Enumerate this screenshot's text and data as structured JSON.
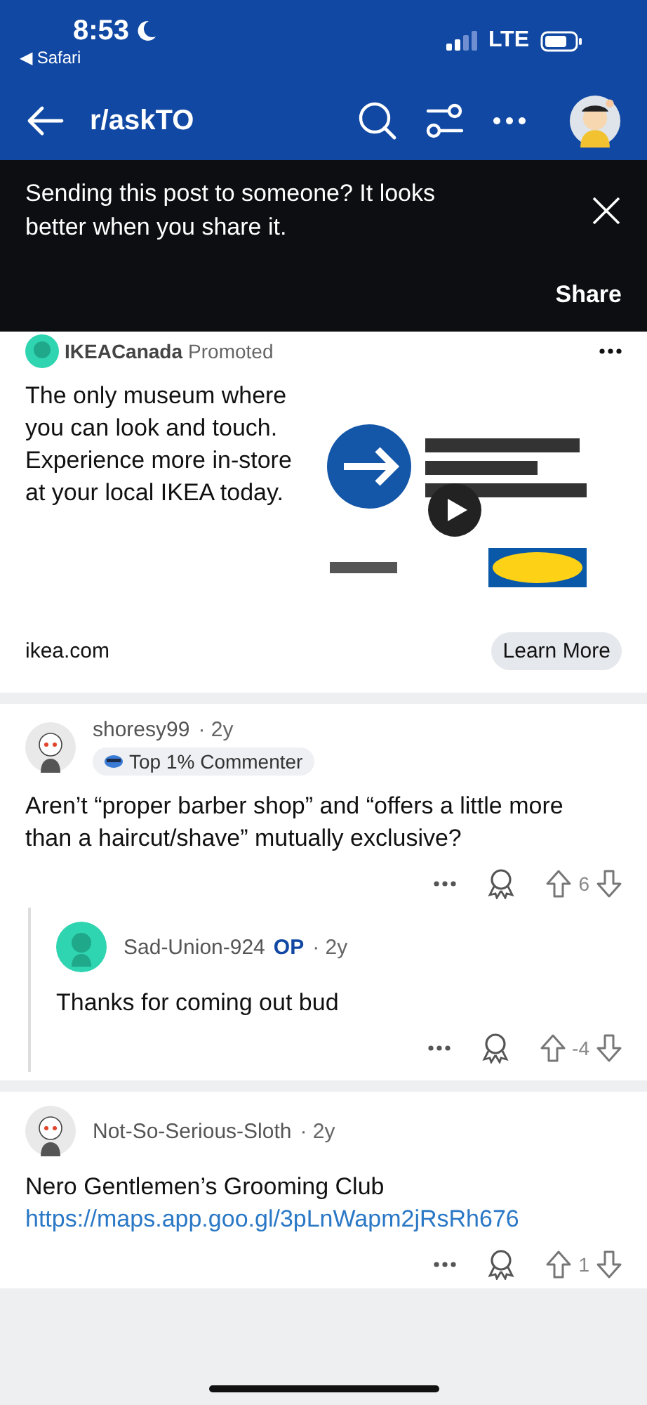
{
  "status_bar": {
    "time": "8:53",
    "back_app": "◀ Safari",
    "network": "LTE"
  },
  "header": {
    "title": "r/askTO"
  },
  "share_banner": {
    "message": "Sending this post to someone? It looks better when you share it.",
    "action": "Share"
  },
  "ad": {
    "advertiser": "IKEACanada",
    "label": "Promoted",
    "text": "The only museum where you can look and touch. Experience more in-store at your local IKEA today.",
    "domain": "ikea.com",
    "button": "Learn More"
  },
  "comments": [
    {
      "author": "shoresy99",
      "age": "· 2y",
      "flair": "Top 1% Commenter",
      "body": "Aren’t “proper barber shop” and “offers a little more than a haircut/shave” mutually exclusive?",
      "score": "6",
      "children": [
        {
          "author": "Sad-Union-924",
          "op_label": "OP",
          "age": "· 2y",
          "body": "Thanks for coming out bud",
          "score": "-4"
        }
      ]
    },
    {
      "author": "Not-So-Serious-Sloth",
      "age": "· 2y",
      "body": "Nero Gentlemen’s Grooming Club",
      "link": "https://maps.app.goo.gl/3pLnWapm2jRsRh676",
      "score": "1"
    }
  ]
}
